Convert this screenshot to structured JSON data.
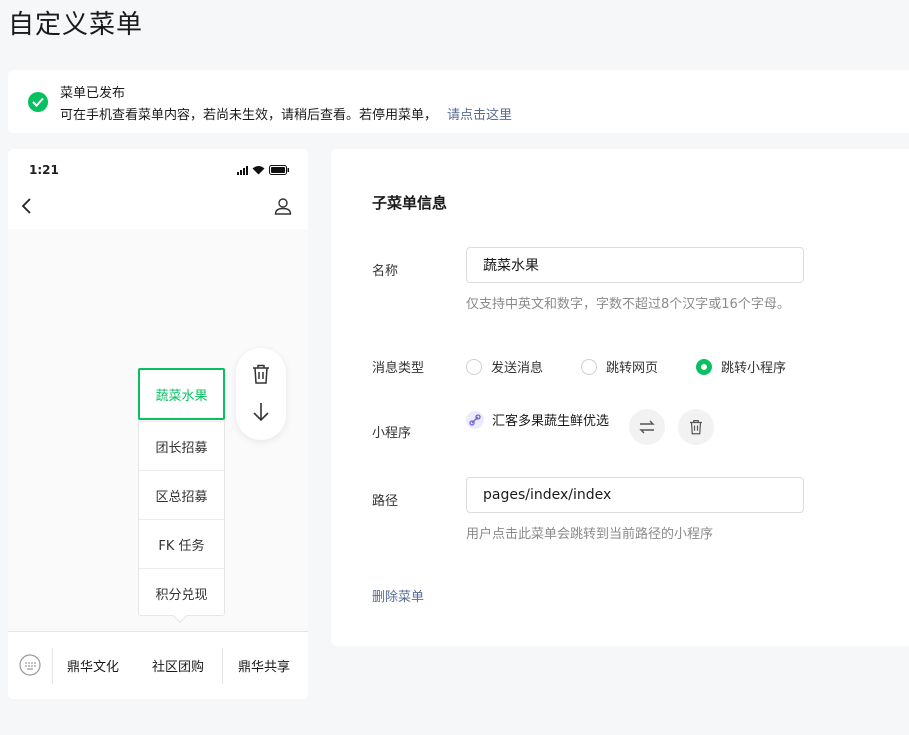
{
  "page": {
    "title": "自定义菜单"
  },
  "notice": {
    "title": "菜单已发布",
    "body": "可在手机查看菜单内容，若尚未生效，请稍后查看。若停用菜单，",
    "link": "请点击这里"
  },
  "phone": {
    "status_time": "1:21",
    "submenu": [
      "蔬菜水果",
      "团长招募",
      "区总招募",
      "FK 任务",
      "积分兑现"
    ],
    "tabs": [
      "鼎华文化",
      "社区团购",
      "鼎华共享"
    ]
  },
  "panel": {
    "title": "子菜单信息",
    "name_label": "名称",
    "name_value": "蔬菜水果",
    "name_hint": "仅支持中英文和数字，字数不超过8个汉字或16个字母。",
    "type_label": "消息类型",
    "type_options": [
      "发送消息",
      "跳转网页",
      "跳转小程序"
    ],
    "type_selected": "跳转小程序",
    "mp_label": "小程序",
    "mp_name": "汇客多果蔬生鲜优选",
    "path_label": "路径",
    "path_value": "pages/index/index",
    "path_hint": "用户点击此菜单会跳转到当前路径的小程序",
    "delete_label": "删除菜单"
  },
  "colors": {
    "accent": "#07c160",
    "link": "#576b95"
  }
}
